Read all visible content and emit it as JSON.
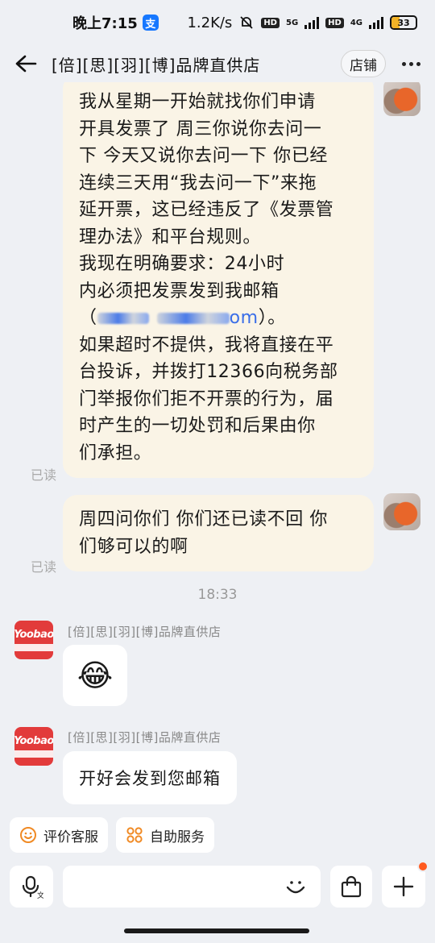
{
  "status_bar": {
    "time": "晚上7:15",
    "alipay_glyph": "支",
    "speed": "1.2K/s",
    "chip_hd_1": "HD",
    "net_1": "5G",
    "chip_hd_2": "HD",
    "net_2": "4G",
    "battery": "33",
    "battery_level": 0.33
  },
  "header": {
    "title": "[倍][思][羽][博]品牌直供店",
    "store_button": "店铺"
  },
  "messages": {
    "m1_before_email": "我从星期一开始就找你们申请\n开具发票了 周三你说你去问一\n下 今天又说你去问一下 你已经\n连续三天用“我去问一下”来拖\n延开票，这已经违反了《发票管\n理办法》和平台规则。\n我现在明确要求：24小时\n内必须把发票发到我邮箱\n（",
    "m1_email_tail": "om",
    "m1_after_email": "）。\n如果超时不提供，我将直接在平\n台投诉，并拨打12366向税务部\n门举报你们拒不开票的行为，届\n时产生的一切处罚和后果由你\n们承担。",
    "m1_read": "已读",
    "m2_text": "周四问你们 你们还已读不回 你\n们够可以的啊",
    "m2_read": "已读",
    "time_divider": "18:33",
    "shop_name_1": "[倍][思][羽][博]品牌直供店",
    "shop_logo": "Yoobao",
    "m3_emoji": "😂",
    "shop_name_2": "[倍][思][羽][博]品牌直供店",
    "m4_text": "开好会发到您邮箱"
  },
  "quick_actions": {
    "rate_label": "评价客服",
    "self_service_label": "自助服务"
  },
  "icons": {
    "back": "back-arrow-icon",
    "more": "more-dots-icon",
    "voice": "voice-icon",
    "emoji": "emoji-icon",
    "bag": "shopping-bag-icon",
    "plus": "plus-icon"
  },
  "colors": {
    "outgoing_bubble": "#faf4e6",
    "incoming_bubble": "#ffffff",
    "background": "#eef0f4",
    "shop_avatar": "#e23b3b",
    "notification_dot": "#ff5a1f",
    "link": "#3a6ee8",
    "quick_action_icon": "#f08a24"
  }
}
